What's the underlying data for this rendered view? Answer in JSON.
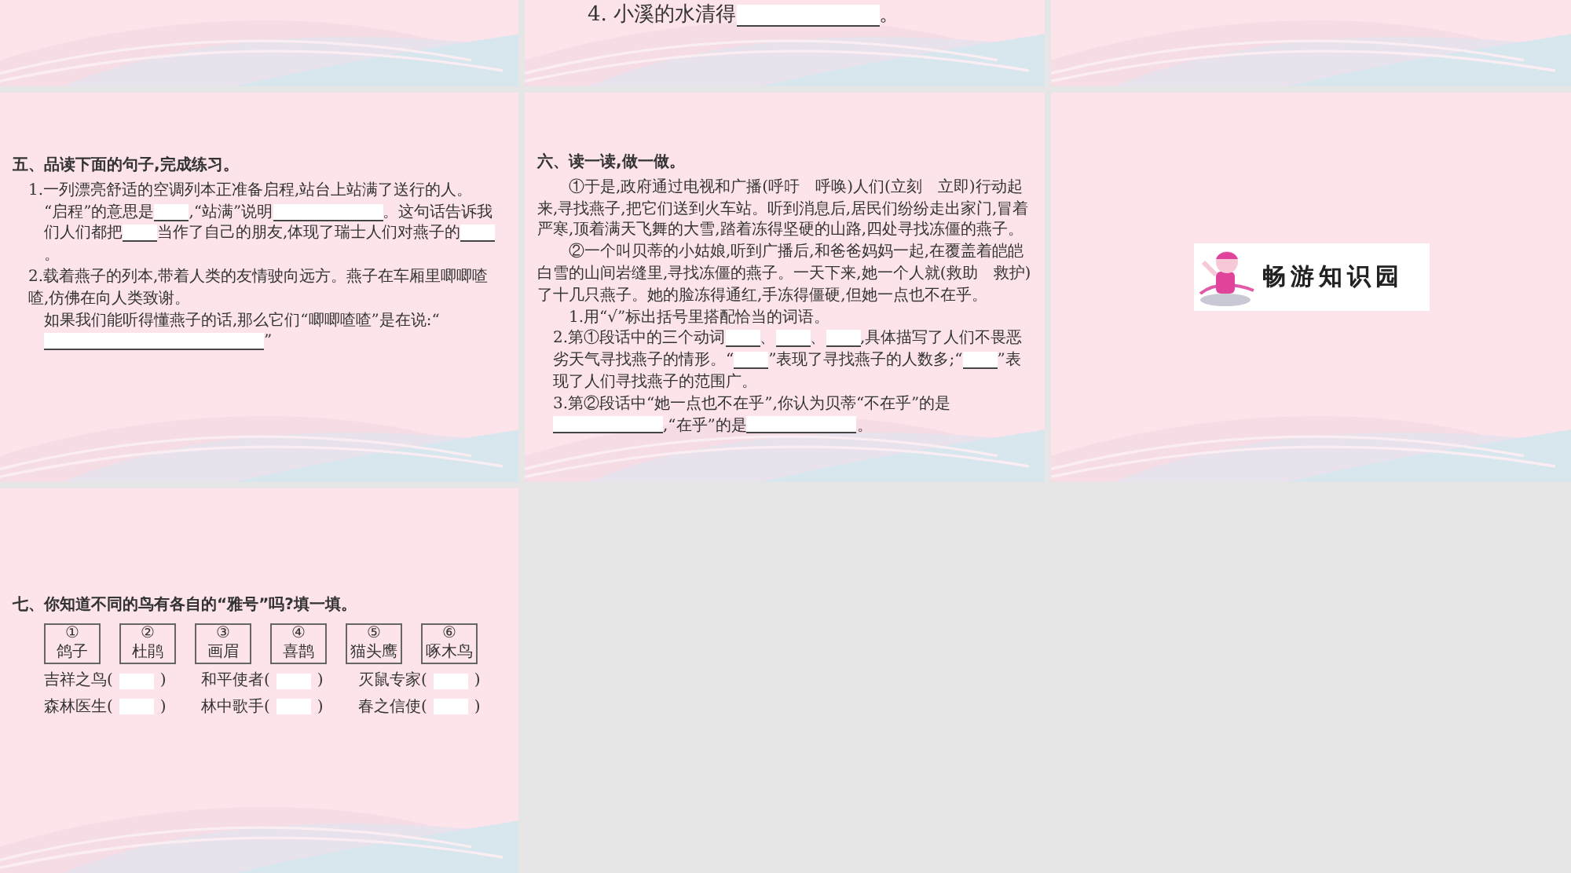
{
  "slides": [
    {
      "kind": "empty"
    },
    {
      "kind": "partial",
      "paragraphs": [
        {
          "kind": "item",
          "parts": [
            {
              "kind": "text",
              "text": "4. 小溪的水清得"
            },
            {
              "kind": "long_blank"
            },
            {
              "kind": "text",
              "text": "。"
            }
          ]
        }
      ]
    },
    {
      "kind": "empty"
    },
    {
      "kind": "exercise",
      "heading": "五、品读下面的句子,完成练习。",
      "paragraphs": [
        {
          "kind": "item",
          "parts": [
            {
              "kind": "text",
              "text": "1.一列漂亮舒适的空调列本正准备启程,站台上站满了送行的人。"
            }
          ]
        },
        {
          "kind": "sub",
          "parts": [
            {
              "kind": "text",
              "text": "“启程”的意思是"
            },
            {
              "kind": "blank"
            },
            {
              "kind": "text",
              "text": ",“站满”说明"
            },
            {
              "kind": "long_blank"
            },
            {
              "kind": "text",
              "text": "。这句话告诉我们人们都把"
            },
            {
              "kind": "blank"
            },
            {
              "kind": "text",
              "text": "当作了自己的朋友,体现了瑞士人们对燕子的"
            },
            {
              "kind": "blank"
            },
            {
              "kind": "text",
              "text": "。"
            }
          ]
        },
        {
          "kind": "item",
          "parts": [
            {
              "kind": "text",
              "text": "2.载着燕子的列本,带着人类的友情驶向远方。燕子在车厢里唧唧喳喳,仿佛在向人类致谢。"
            }
          ]
        },
        {
          "kind": "sub",
          "parts": [
            {
              "kind": "text",
              "text": "如果我们能听得懂燕子的话,那么它们“唧唧喳喳”是在说:“"
            },
            {
              "kind": "long_blank"
            },
            {
              "kind": "long_blank"
            },
            {
              "kind": "text",
              "text": "”"
            }
          ]
        }
      ]
    },
    {
      "kind": "exercise",
      "heading": "六、读一读,做一做。",
      "paragraphs": [
        {
          "kind": "passage",
          "parts": [
            {
              "kind": "text",
              "text": "①于是,政府通过电视和广播(呼吁　呼唤)人们(立刻　立即)行动起来,寻找燕子,把它们送到火车站。听到消息后,居民们纷纷走出家门,冒着严寒,顶着满天飞舞的大雪,踏着冻得坚硬的山路,四处寻找冻僵的燕子。"
            }
          ]
        },
        {
          "kind": "passage",
          "parts": [
            {
              "kind": "text",
              "text": "②一个叫贝蒂的小姑娘,听到广播后,和爸爸妈妈一起,在覆盖着皑皑白雪的山间岩缝里,寻找冻僵的燕子。一天下来,她一个人就(救助　救护)了十几只燕子。她的脸冻得通红,手冻得僵硬,但她一点也不在乎。"
            }
          ]
        },
        {
          "kind": "sub",
          "parts": [
            {
              "kind": "text",
              "text": "1.用“√”标出括号里搭配恰当的词语。"
            }
          ]
        },
        {
          "kind": "item",
          "parts": [
            {
              "kind": "text",
              "text": "2.第①段话中的三个动词"
            },
            {
              "kind": "blank"
            },
            {
              "kind": "text",
              "text": "、"
            },
            {
              "kind": "blank"
            },
            {
              "kind": "text",
              "text": "、"
            },
            {
              "kind": "blank"
            },
            {
              "kind": "text",
              "text": ",具体描写了人们不畏恶劣天气寻找燕子的情形。“"
            },
            {
              "kind": "blank"
            },
            {
              "kind": "text",
              "text": "”表现了寻找燕子的人数多;“"
            },
            {
              "kind": "blank"
            },
            {
              "kind": "text",
              "text": "”表现了人们寻找燕子的范围广。"
            }
          ]
        },
        {
          "kind": "item",
          "parts": [
            {
              "kind": "text",
              "text": "3.第②段话中“她一点也不在乎”,你认为贝蒂“不在乎”的是"
            },
            {
              "kind": "long_blank"
            },
            {
              "kind": "text",
              "text": ",“在乎”的是"
            },
            {
              "kind": "long_blank"
            },
            {
              "kind": "text",
              "text": "。"
            }
          ]
        }
      ]
    },
    {
      "kind": "banner",
      "title": "畅游知识园"
    },
    {
      "kind": "birds",
      "heading": "七、你知道不同的鸟有各自的“雅号”吗?填一填。",
      "birds": [
        {
          "number": "①",
          "name": "鸽子"
        },
        {
          "number": "②",
          "name": "杜鹃"
        },
        {
          "number": "③",
          "name": "画眉"
        },
        {
          "number": "④",
          "name": "喜鹊"
        },
        {
          "number": "⑤",
          "name": "猫头鹰"
        },
        {
          "number": "⑥",
          "name": "啄木鸟"
        }
      ],
      "slots": [
        {
          "label": "吉祥之鸟(",
          "close": ")"
        },
        {
          "label": "和平使者(",
          "close": ")"
        },
        {
          "label": "灭鼠专家(",
          "close": ")"
        },
        {
          "label": "森林医生(",
          "close": ")"
        },
        {
          "label": "林中歌手(",
          "close": ")"
        },
        {
          "label": "春之信使(",
          "close": ")"
        }
      ]
    }
  ]
}
